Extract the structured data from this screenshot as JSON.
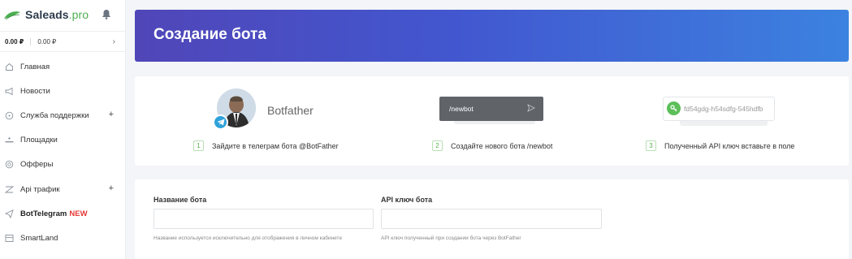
{
  "brand": {
    "name": "Saleads",
    "suffix": ".pro"
  },
  "balance": {
    "main": "0.00 ₽",
    "secondary": "0.00 ₽"
  },
  "nav": [
    {
      "label": "Главная",
      "icon": "home-icon",
      "plus": ""
    },
    {
      "label": "Новости",
      "icon": "megaphone-icon",
      "plus": ""
    },
    {
      "label": "Служба поддержки",
      "icon": "chat-icon",
      "plus": "+"
    },
    {
      "label": "Площадки",
      "icon": "sites-icon",
      "plus": ""
    },
    {
      "label": "Офферы",
      "icon": "offers-icon",
      "plus": ""
    },
    {
      "label": "Api трафик",
      "icon": "api-icon",
      "plus": "+"
    },
    {
      "label": "BotTelegram",
      "icon": "send-icon",
      "plus": "",
      "badge": "NEW"
    },
    {
      "label": "SmartLand",
      "icon": "landing-icon",
      "plus": ""
    }
  ],
  "page": {
    "title": "Создание бота"
  },
  "steps": {
    "bot_name": "Botfather",
    "command": "/newbot",
    "api_key_example": "fd54gdg-h54sdfg-545hdfb",
    "items": [
      {
        "num": "1",
        "text": "Зайдите в телеграм бота @BotFather"
      },
      {
        "num": "2",
        "text": "Создайте нового бота /newbot"
      },
      {
        "num": "3",
        "text": "Полученный API ключ вставьте в поле"
      }
    ]
  },
  "form": {
    "name_label": "Название бота",
    "name_value": "",
    "name_hint": "Название используется исключительно для отображения в личном кабинете",
    "key_label": "API ключ бота",
    "key_value": "",
    "key_hint": "API ключ полученный при создании бота через BotFather"
  },
  "colors": {
    "accent_green": "#4caf50",
    "banner_start": "#5046b8",
    "banner_end": "#3c82e0",
    "new_badge": "#e53935"
  }
}
